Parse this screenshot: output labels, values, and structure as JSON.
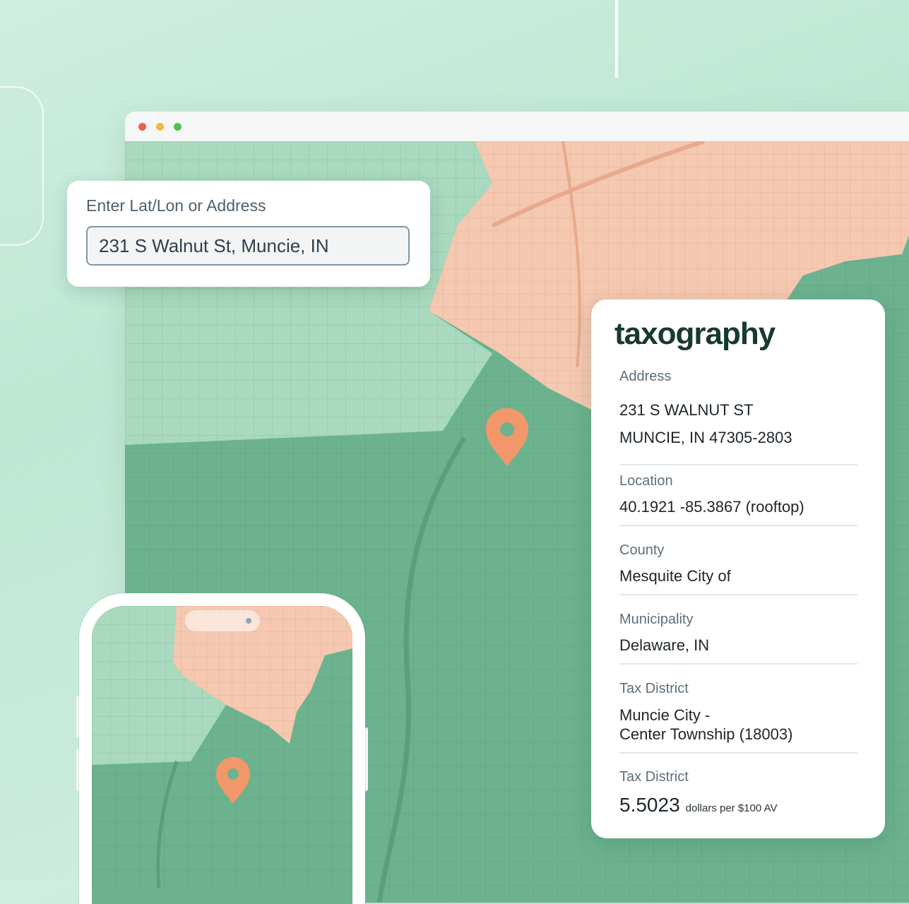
{
  "search": {
    "label": "Enter Lat/Lon or Address",
    "value": "231 S Walnut St, Muncie, IN"
  },
  "info": {
    "brand": "taxography",
    "address": {
      "label": "Address",
      "line1": "231 S WALNUT ST",
      "line2": "MUNCIE, IN 47305-2803"
    },
    "location": {
      "label": "Location",
      "value": "40.1921 -85.3867 (rooftop)"
    },
    "county": {
      "label": "County",
      "value": "Mesquite City of"
    },
    "municipality": {
      "label": "Municipality",
      "value": "Delaware, IN"
    },
    "tax_district": {
      "label": "Tax District",
      "line1": "Muncie City -",
      "line2": "Center Township (18003)"
    },
    "tax_rate": {
      "label": "Tax District",
      "value": "5.5023",
      "unit": "dollars  per $100 AV"
    }
  },
  "colors": {
    "map_dark_green": "#6cb28f",
    "map_light_green": "#a9d9bf",
    "map_peach": "#f5c8b1",
    "pin": "#f2976a"
  },
  "icons": {
    "map_pin": "map-pin-icon"
  }
}
